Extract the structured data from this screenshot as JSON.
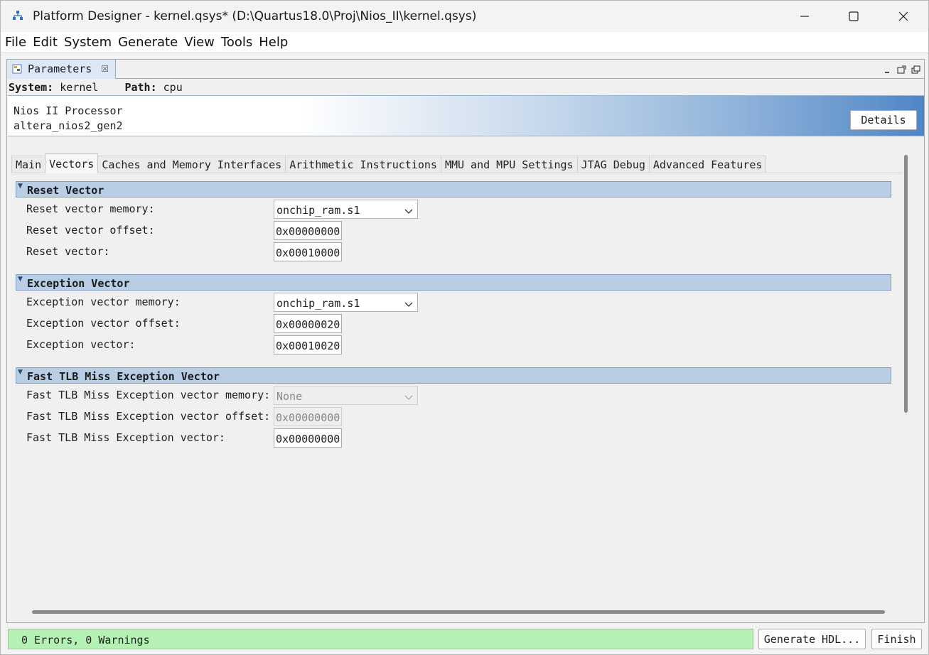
{
  "window": {
    "title": "Platform Designer - kernel.qsys* (D:\\Quartus18.0\\Proj\\Nios_II\\kernel.qsys)",
    "controls": [
      "minimize-icon",
      "maximize-icon",
      "close-icon"
    ]
  },
  "menu": [
    "File",
    "Edit",
    "System",
    "Generate",
    "View",
    "Tools",
    "Help"
  ],
  "view_tab": {
    "label": "Parameters",
    "close_glyph": "☒"
  },
  "system_line": {
    "system_label": "System:",
    "system_value": "kernel",
    "path_label": "Path:",
    "path_value": "cpu"
  },
  "component": {
    "name": "Nios II Processor",
    "id": "altera_nios2_gen2",
    "details_label": "Details"
  },
  "param_tabs": [
    {
      "label": "Main",
      "active": false
    },
    {
      "label": "Vectors",
      "active": true
    },
    {
      "label": "Caches and Memory Interfaces",
      "active": false
    },
    {
      "label": "Arithmetic Instructions",
      "active": false
    },
    {
      "label": "MMU and MPU Settings",
      "active": false
    },
    {
      "label": "JTAG Debug",
      "active": false
    },
    {
      "label": "Advanced Features",
      "active": false
    }
  ],
  "sections": [
    {
      "title": "Reset Vector",
      "rows": [
        {
          "label": "Reset vector memory:",
          "kind": "select",
          "value": "onchip_ram.s1",
          "enabled": true
        },
        {
          "label": "Reset vector offset:",
          "kind": "input",
          "value": "0x00000000",
          "enabled": true
        },
        {
          "label": "Reset vector:",
          "kind": "input",
          "value": "0x00010000",
          "enabled": true
        }
      ]
    },
    {
      "title": "Exception Vector",
      "rows": [
        {
          "label": "Exception vector memory:",
          "kind": "select",
          "value": "onchip_ram.s1",
          "enabled": true
        },
        {
          "label": "Exception vector offset:",
          "kind": "input",
          "value": "0x00000020",
          "enabled": true
        },
        {
          "label": "Exception vector:",
          "kind": "input",
          "value": "0x00010020",
          "enabled": true
        }
      ]
    },
    {
      "title": "Fast TLB Miss Exception Vector",
      "rows": [
        {
          "label": "Fast TLB Miss Exception vector memory:",
          "kind": "select",
          "value": "None",
          "enabled": false
        },
        {
          "label": "Fast TLB Miss Exception vector offset:",
          "kind": "input",
          "value": "0x00000000",
          "enabled": false
        },
        {
          "label": "Fast TLB Miss Exception vector:",
          "kind": "input",
          "value": "0x00000000",
          "enabled": true
        }
      ]
    }
  ],
  "status": {
    "text": "0 Errors, 0 Warnings",
    "color": "#b5f1b5"
  },
  "buttons": {
    "generate": "Generate HDL...",
    "finish": "Finish"
  }
}
